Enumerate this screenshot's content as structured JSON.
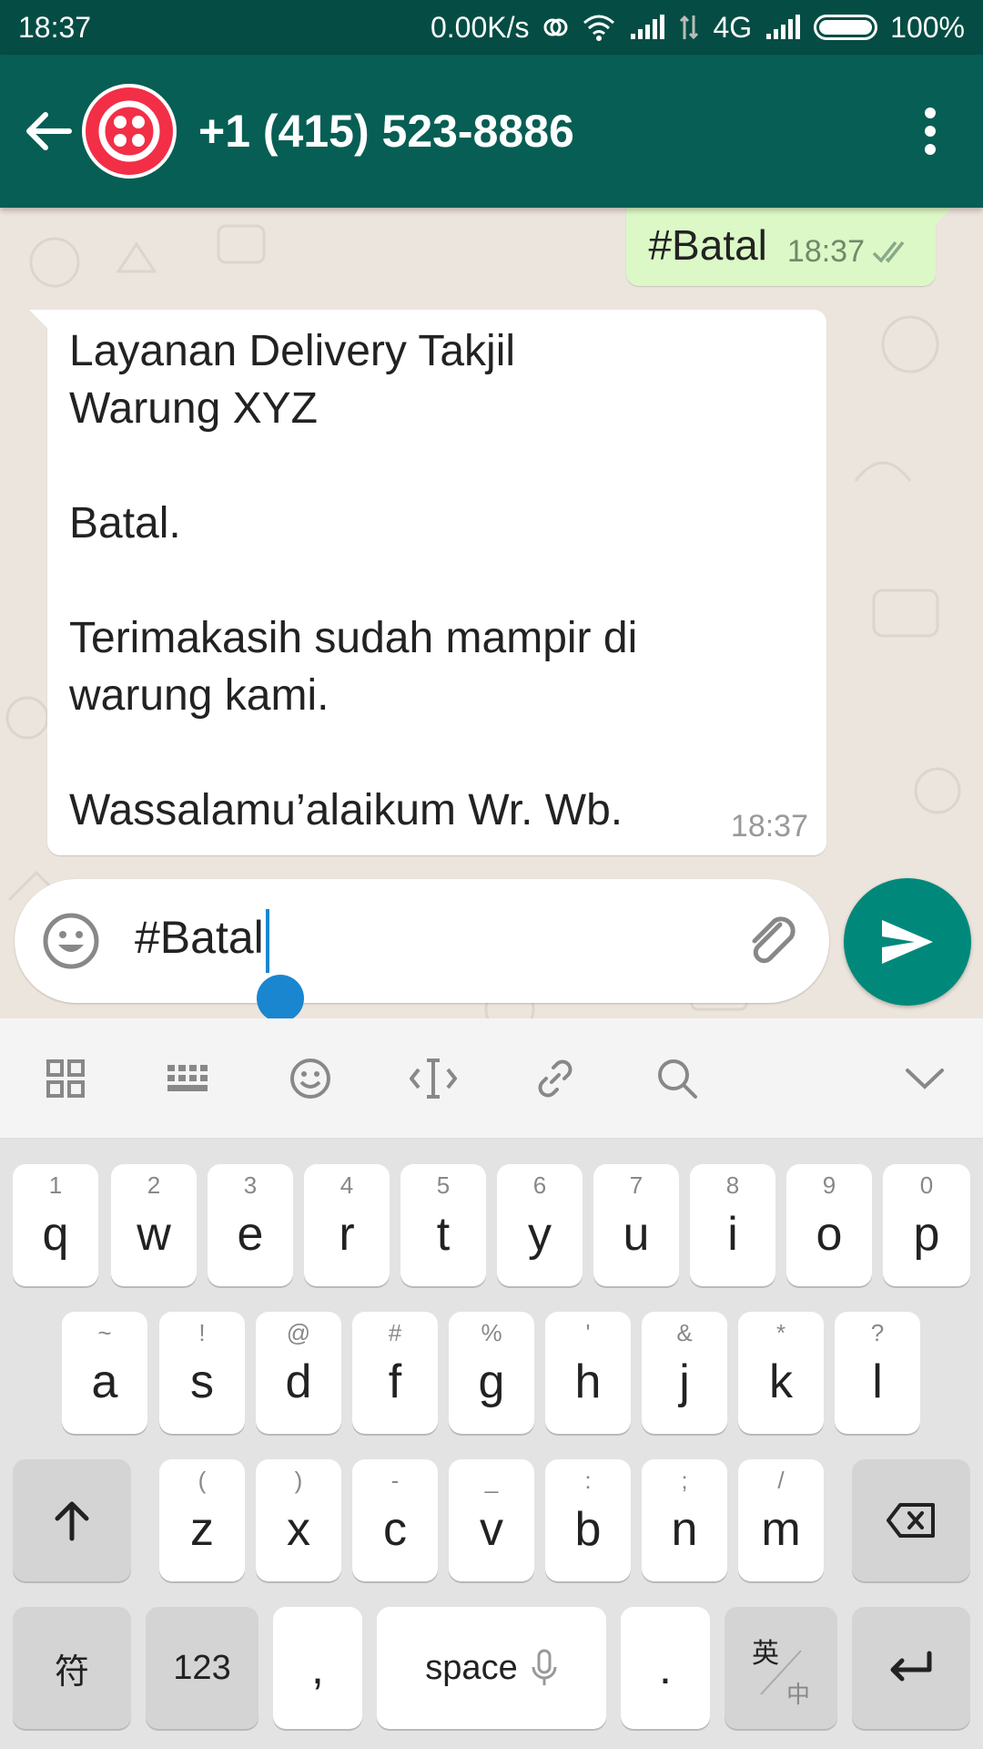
{
  "status_bar": {
    "time": "18:37",
    "net_speed": "0.00K/s",
    "network_type": "4G",
    "battery": "100%"
  },
  "header": {
    "contact_name": "+1 (415) 523-8886"
  },
  "chat": {
    "outgoing": {
      "text": "#Batal",
      "time": "18:37",
      "status": "double-check"
    },
    "incoming": {
      "lines": [
        "Layanan  Delivery  Takjil",
        "Warung  XYZ",
        "",
        "Batal.",
        "",
        "Terimakasih sudah mampir di",
        "warung kami.",
        "",
        "Wassalamu’alaikum Wr. Wb."
      ],
      "time": "18:37"
    }
  },
  "composer": {
    "text": "#Batal"
  },
  "keyboard": {
    "row1": [
      {
        "main": "q",
        "sub": "1"
      },
      {
        "main": "w",
        "sub": "2"
      },
      {
        "main": "e",
        "sub": "3"
      },
      {
        "main": "r",
        "sub": "4"
      },
      {
        "main": "t",
        "sub": "5"
      },
      {
        "main": "y",
        "sub": "6"
      },
      {
        "main": "u",
        "sub": "7"
      },
      {
        "main": "i",
        "sub": "8"
      },
      {
        "main": "o",
        "sub": "9"
      },
      {
        "main": "p",
        "sub": "0"
      }
    ],
    "row2": [
      {
        "main": "a",
        "sub": "~"
      },
      {
        "main": "s",
        "sub": "!"
      },
      {
        "main": "d",
        "sub": "@"
      },
      {
        "main": "f",
        "sub": "#"
      },
      {
        "main": "g",
        "sub": "%"
      },
      {
        "main": "h",
        "sub": "'"
      },
      {
        "main": "j",
        "sub": "&"
      },
      {
        "main": "k",
        "sub": "*"
      },
      {
        "main": "l",
        "sub": "?"
      }
    ],
    "row3": [
      {
        "main": "z",
        "sub": "("
      },
      {
        "main": "x",
        "sub": ")"
      },
      {
        "main": "c",
        "sub": "-"
      },
      {
        "main": "v",
        "sub": "_"
      },
      {
        "main": "b",
        "sub": ":"
      },
      {
        "main": "n",
        "sub": ";"
      },
      {
        "main": "m",
        "sub": "/"
      }
    ],
    "bottom": {
      "symbols": "符",
      "numbers": "123",
      "comma": ",",
      "space": "space",
      "period": ".",
      "lang_top": "英",
      "lang_bottom": "中"
    }
  },
  "colors": {
    "status_bar": "#054d44",
    "app_bar": "#075e54",
    "outgoing_bubble": "#dcf8c6",
    "send_button": "#00897b",
    "caret": "#1a86d0",
    "avatar": "#f22f46"
  }
}
